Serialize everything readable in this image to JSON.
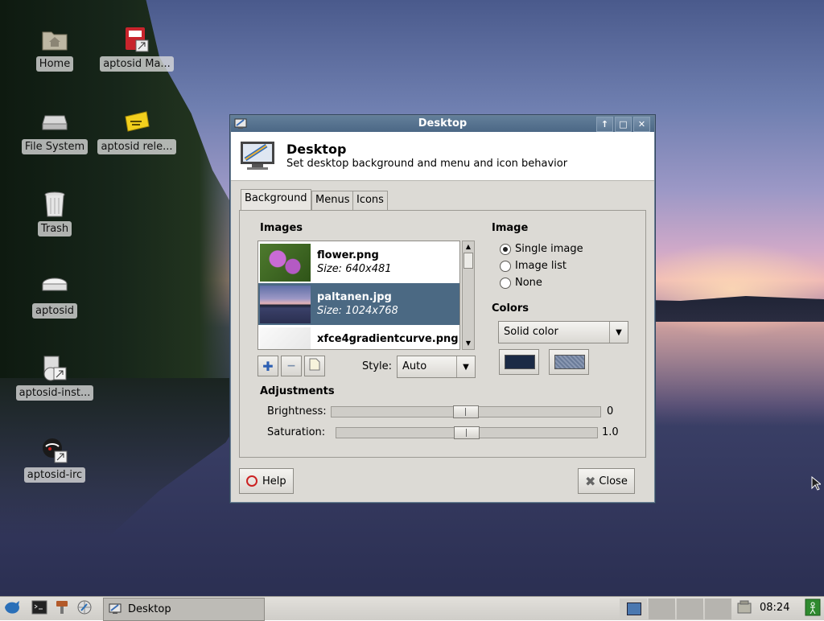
{
  "desktop": {
    "icons": [
      {
        "label": "Home",
        "icon": "home-folder-icon"
      },
      {
        "label": "aptosid Ma...",
        "icon": "manual-icon"
      },
      {
        "label": "File System",
        "icon": "harddisk-icon"
      },
      {
        "label": "aptosid rele...",
        "icon": "release-notes-icon"
      },
      {
        "label": "Trash",
        "icon": "trash-icon"
      },
      {
        "label": "aptosid",
        "icon": "drive-icon"
      },
      {
        "label": "aptosid-inst...",
        "icon": "installer-icon"
      },
      {
        "label": "aptosid-irc",
        "icon": "irc-icon"
      }
    ]
  },
  "window": {
    "title": "Desktop",
    "header_title": "Desktop",
    "header_subtitle": "Set desktop background and menu and icon behavior",
    "tabs": [
      {
        "label": "Background",
        "active": true
      },
      {
        "label": "Menus",
        "active": false
      },
      {
        "label": "Icons",
        "active": false
      }
    ],
    "images_section": "Images",
    "images": [
      {
        "name": "flower.png",
        "size": "Size: 640x481",
        "selected": false
      },
      {
        "name": "paltanen.jpg",
        "size": "Size: 1024x768",
        "selected": true
      },
      {
        "name": "xfce4gradientcurve.png",
        "size": "",
        "selected": false
      }
    ],
    "style_label": "Style:",
    "style_value": "Auto",
    "image_section": "Image",
    "image_modes": [
      {
        "label": "Single image",
        "checked": true
      },
      {
        "label": "Image list",
        "checked": false
      },
      {
        "label": "None",
        "checked": false
      }
    ],
    "colors_section": "Colors",
    "color_mode": "Solid color",
    "color1": "#1b2a45",
    "color2": "#6b7c99",
    "adjustments_section": "Adjustments",
    "brightness_label": "Brightness:",
    "brightness_value": "0",
    "brightness_level": 0.5,
    "saturation_label": "Saturation:",
    "saturation_value": "1.0",
    "saturation_level": 0.5,
    "help_label": "Help",
    "close_label": "Close"
  },
  "taskbar": {
    "task_label": "Desktop",
    "clock": "08:24"
  }
}
